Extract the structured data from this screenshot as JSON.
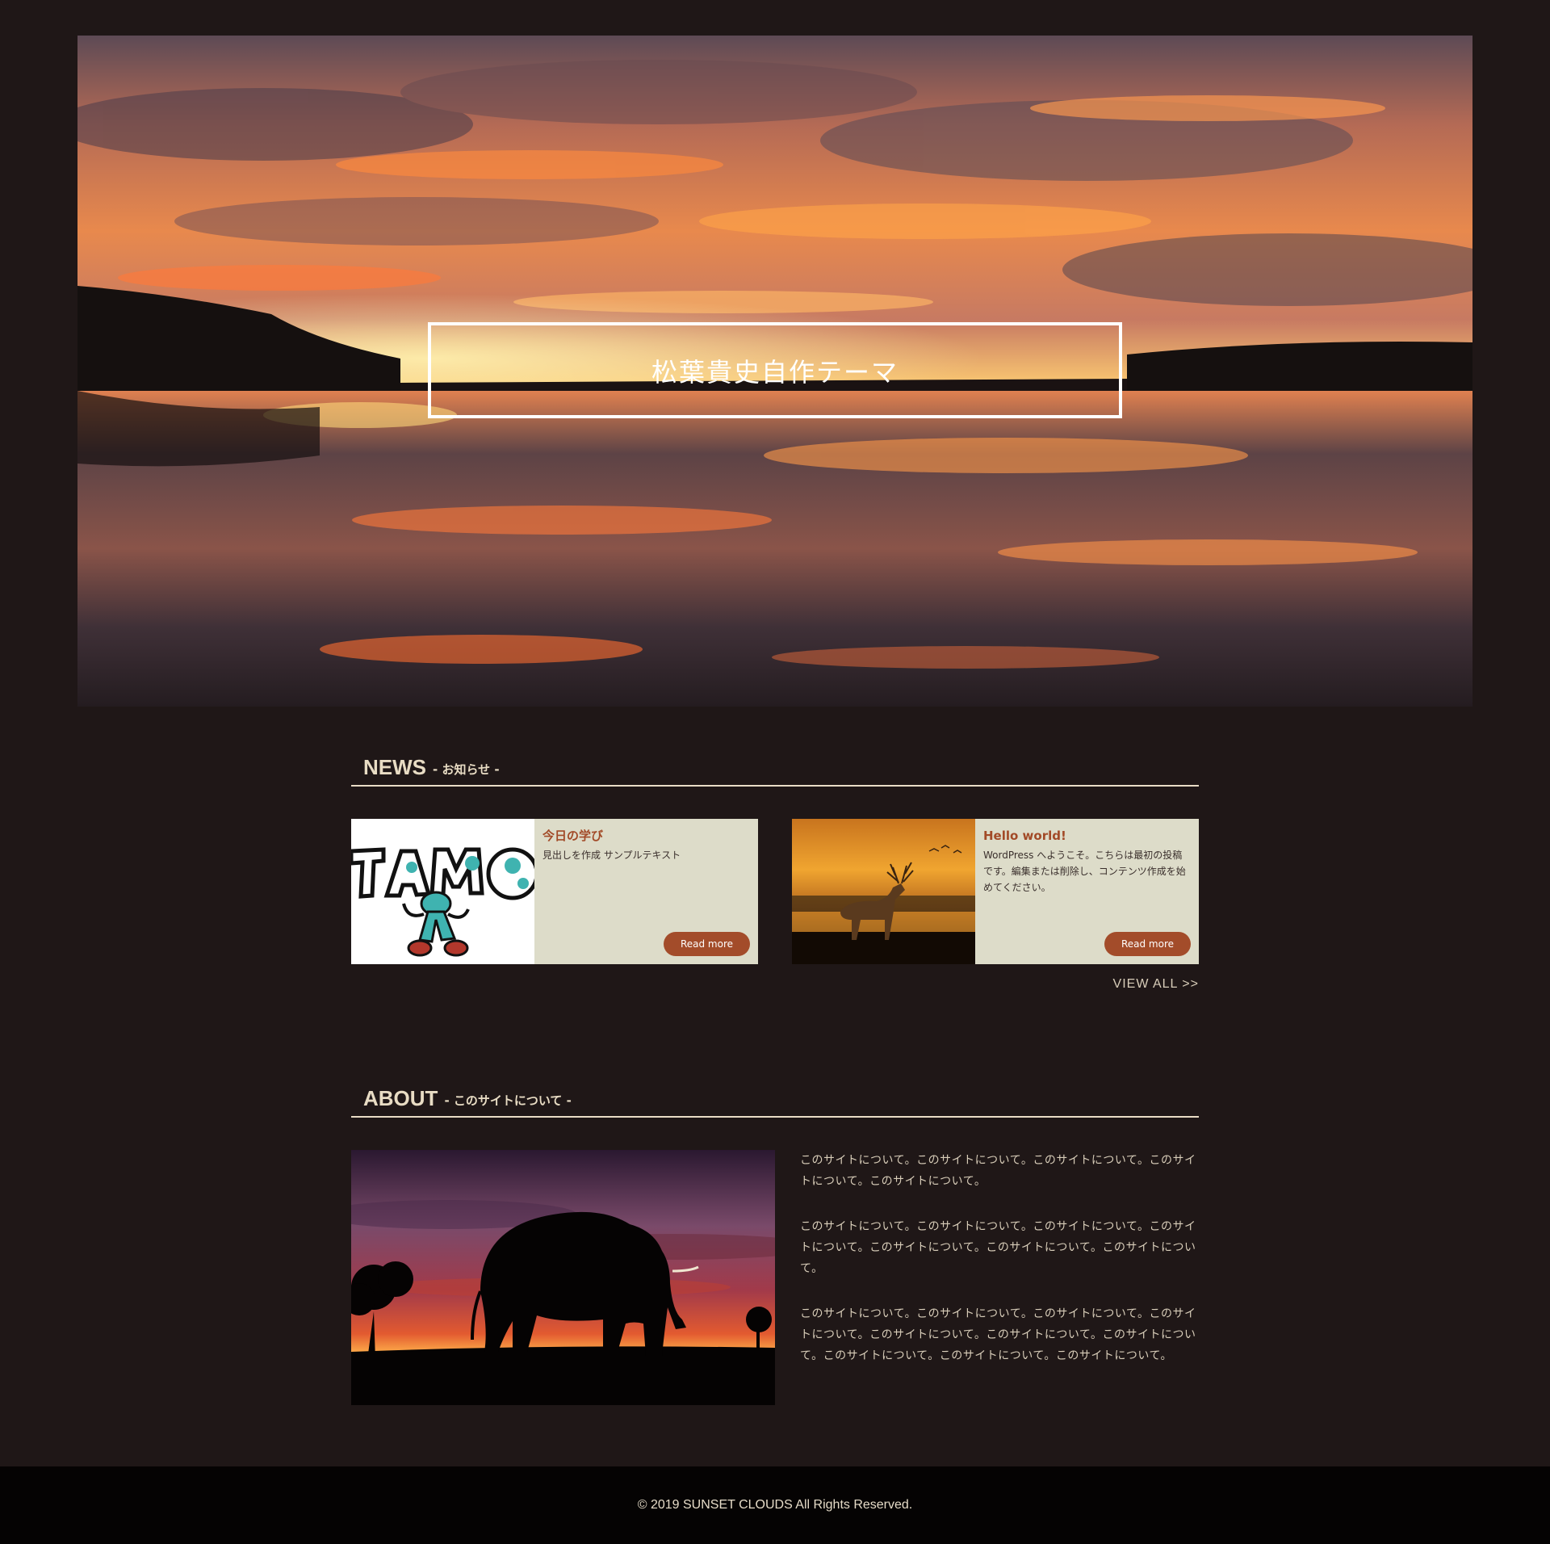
{
  "hero": {
    "title": "松葉貴史自作テーマ",
    "image": "sunset-lake-photo"
  },
  "news": {
    "heading": "NEWS",
    "subheading": "- お知らせ -",
    "posts": [
      {
        "title": "今日の学び",
        "excerpt": "見出しを作成 サンプルテキスト",
        "image": "tamo-illustration",
        "read_more": "Read more"
      },
      {
        "title": "Hello world!",
        "excerpt": "WordPress へようこそ。こちらは最初の投稿です。編集または削除し、コンテンツ作成を始めてください。",
        "image": "deer-sunset-photo",
        "read_more": "Read more"
      }
    ],
    "view_all": "VIEW ALL >>"
  },
  "about": {
    "heading": "ABOUT",
    "subheading": "- このサイトについて -",
    "image": "elephant-sunset-silhouette",
    "paragraphs": [
      "このサイトについて。このサイトについて。このサイトについて。このサイトについて。このサイトについて。",
      "このサイトについて。このサイトについて。このサイトについて。このサイトについて。このサイトについて。このサイトについて。このサイトについて。",
      "このサイトについて。このサイトについて。このサイトについて。このサイトについて。このサイトについて。このサイトについて。このサイトについて。このサイトについて。このサイトについて。このサイトについて。"
    ]
  },
  "footer": {
    "copyright": "© 2019 SUNSET CLOUDS All Rights Reserved."
  },
  "colors": {
    "background": "#1f1717",
    "accent": "#a34c2a",
    "card_background": "#dddcc9",
    "heading_text": "#e8dcc4",
    "footer_background": "#050303"
  }
}
